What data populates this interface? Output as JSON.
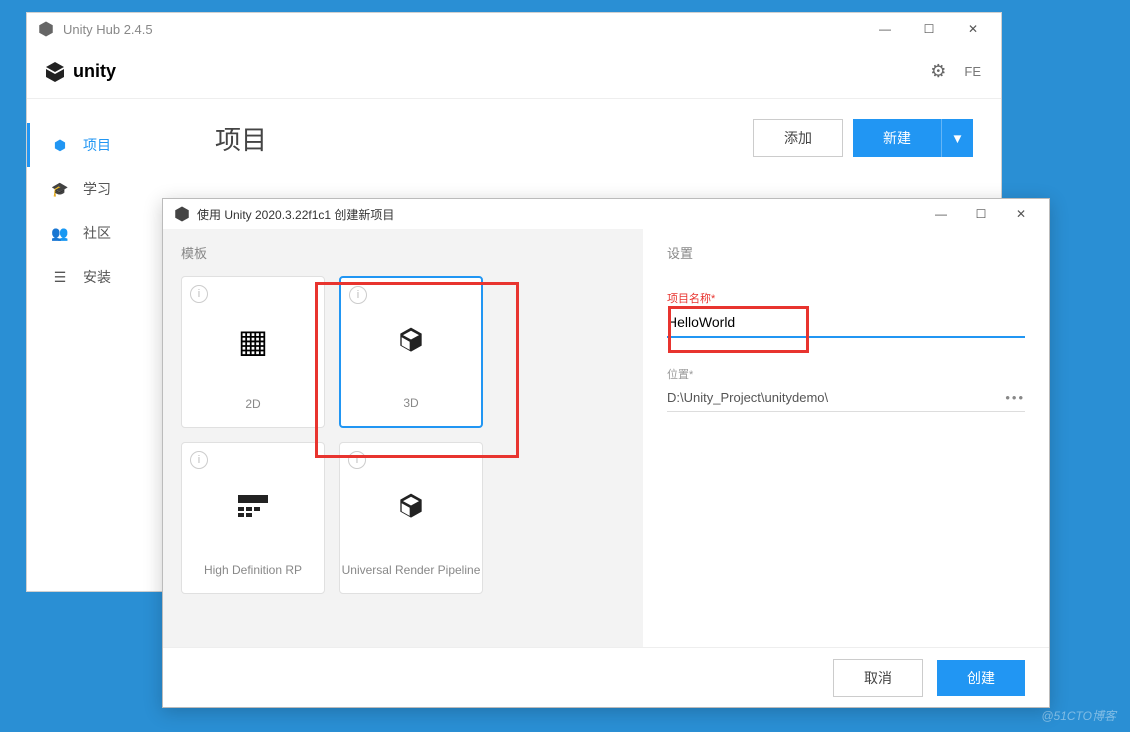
{
  "hub": {
    "title": "Unity Hub 2.4.5",
    "logo": "unity",
    "user_initials": "FE",
    "sidebar": {
      "items": [
        {
          "label": "项目",
          "icon": "cube"
        },
        {
          "label": "学习",
          "icon": "grad"
        },
        {
          "label": "社区",
          "icon": "group"
        },
        {
          "label": "安装",
          "icon": "menu"
        }
      ]
    },
    "main": {
      "title": "项目",
      "add_label": "添加",
      "new_label": "新建"
    }
  },
  "new_project": {
    "title": "使用 Unity 2020.3.22f1c1 创建新项目",
    "templates_label": "模板",
    "settings_label": "设置",
    "templates": [
      {
        "name": "2D"
      },
      {
        "name": "3D"
      },
      {
        "name": "High Definition RP"
      },
      {
        "name": "Universal Render Pipeline"
      }
    ],
    "fields": {
      "name_label": "项目名称*",
      "name_value": "HelloWorld",
      "location_label": "位置*",
      "location_value": "D:\\Unity_Project\\unitydemo\\"
    },
    "buttons": {
      "cancel": "取消",
      "create": "创建"
    }
  },
  "watermark": "@51CTO博客"
}
